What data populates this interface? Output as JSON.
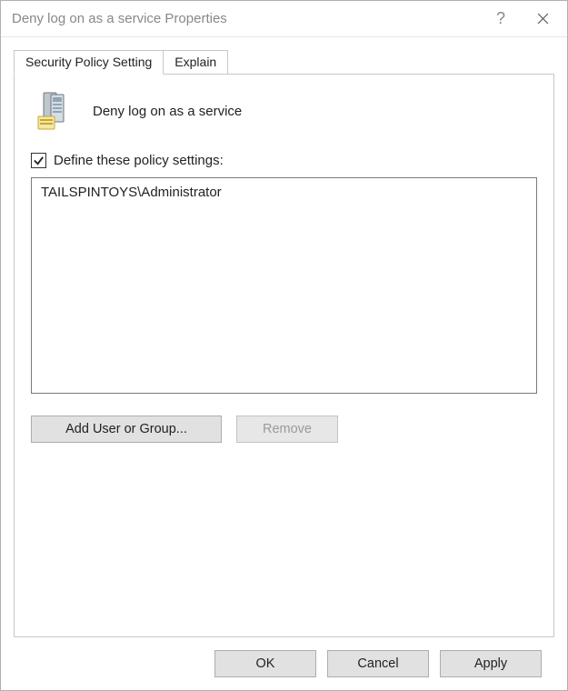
{
  "window": {
    "title": "Deny log on as a service Properties"
  },
  "tabs": {
    "security": "Security Policy Setting",
    "explain": "Explain"
  },
  "page": {
    "policy_name": "Deny log on as a service",
    "define_checkbox_label": "Define these policy settings:",
    "define_checked": true,
    "entries": [
      "TAILSPINTOYS\\Administrator"
    ]
  },
  "buttons": {
    "add": "Add User or Group...",
    "remove": "Remove",
    "ok": "OK",
    "cancel": "Cancel",
    "apply": "Apply"
  }
}
